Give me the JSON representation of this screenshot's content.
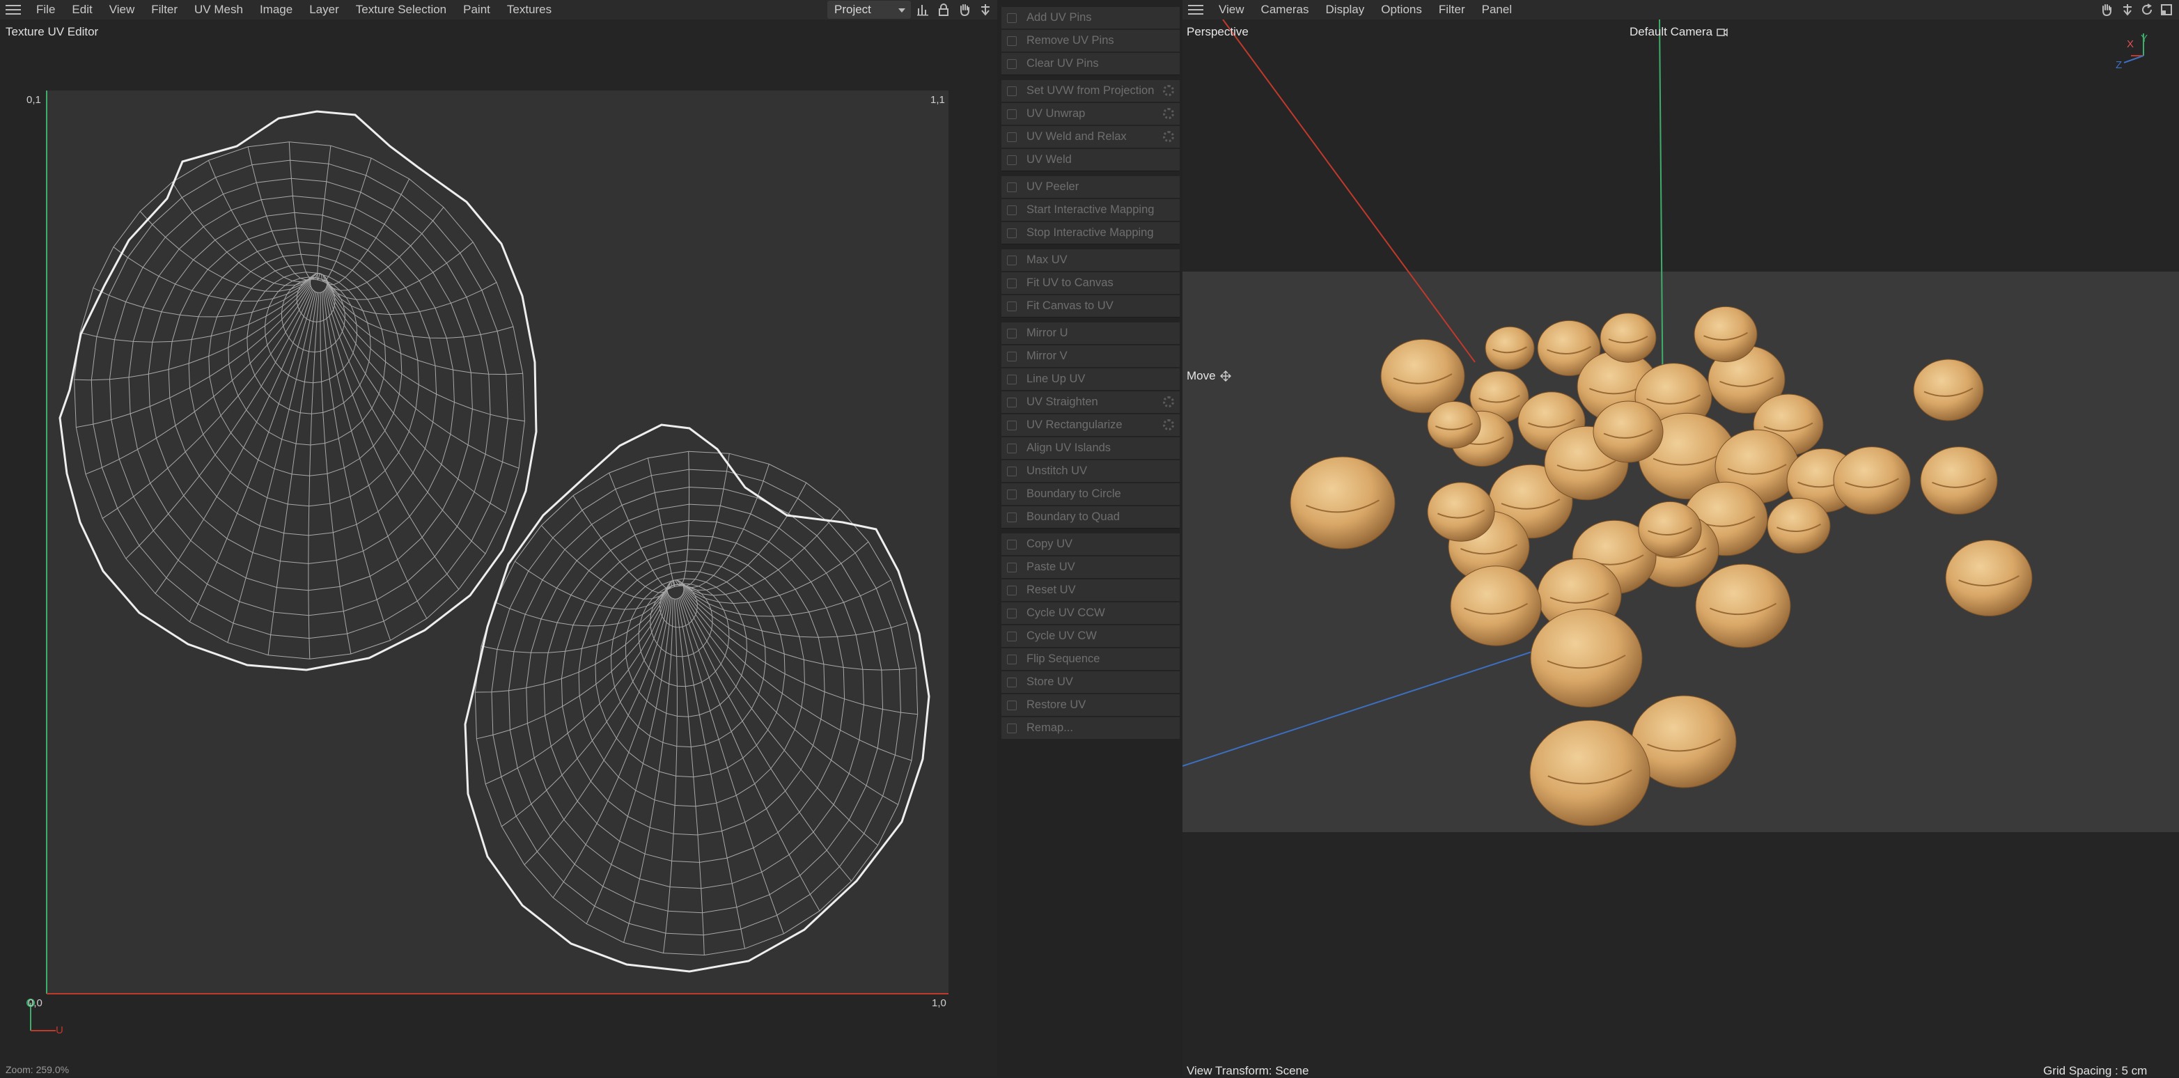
{
  "uv_editor": {
    "menu": [
      "File",
      "Edit",
      "View",
      "Filter",
      "UV Mesh",
      "Image",
      "Layer",
      "Texture Selection",
      "Paint",
      "Textures"
    ],
    "project_select": "Project",
    "title": "Texture UV Editor",
    "corner_labels": {
      "top_left": "0,1",
      "top_right": "1,1",
      "bottom_left": "0,0",
      "bottom_right": "1,0"
    },
    "axis_label_u": "U",
    "zoom_text": "Zoom: 259.0%"
  },
  "commands": [
    {
      "label": "Add UV Pins",
      "gear": false
    },
    {
      "label": "Remove UV Pins",
      "gear": false
    },
    {
      "label": "Clear UV Pins",
      "gear": false
    },
    {
      "label": "Set UVW from Projection",
      "gear": true
    },
    {
      "label": "UV Unwrap",
      "gear": true
    },
    {
      "label": "UV Weld and Relax",
      "gear": true
    },
    {
      "label": "UV Weld",
      "gear": false
    },
    {
      "label": "UV Peeler",
      "gear": false
    },
    {
      "label": "Start Interactive Mapping",
      "gear": false
    },
    {
      "label": "Stop Interactive Mapping",
      "gear": false
    },
    {
      "label": "Max UV",
      "gear": false
    },
    {
      "label": "Fit UV to Canvas",
      "gear": false
    },
    {
      "label": "Fit Canvas to UV",
      "gear": false
    },
    {
      "label": "Mirror U",
      "gear": false
    },
    {
      "label": "Mirror V",
      "gear": false
    },
    {
      "label": "Line Up UV",
      "gear": false
    },
    {
      "label": "UV Straighten",
      "gear": true
    },
    {
      "label": "UV Rectangularize",
      "gear": true
    },
    {
      "label": "Align UV Islands",
      "gear": false
    },
    {
      "label": "Unstitch UV",
      "gear": false
    },
    {
      "label": "Boundary to Circle",
      "gear": false
    },
    {
      "label": "Boundary to Quad",
      "gear": false
    },
    {
      "label": "Copy UV",
      "gear": false
    },
    {
      "label": "Paste UV",
      "gear": false
    },
    {
      "label": "Reset UV",
      "gear": false
    },
    {
      "label": "Cycle UV CCW",
      "gear": false
    },
    {
      "label": "Cycle UV CW",
      "gear": false
    },
    {
      "label": "Flip Sequence",
      "gear": false
    },
    {
      "label": "Store UV",
      "gear": false
    },
    {
      "label": "Restore UV",
      "gear": false
    },
    {
      "label": "Remap...",
      "gear": false
    }
  ],
  "viewport": {
    "menu": [
      "View",
      "Cameras",
      "Display",
      "Options",
      "Filter",
      "Panel"
    ],
    "perspective_label": "Perspective",
    "camera_label": "Default Camera",
    "move_label": "Move",
    "axis_x": "X",
    "axis_y": "Y",
    "axis_z": "Z",
    "view_transform": "View Transform: Scene",
    "grid_spacing": "Grid Spacing : 5 cm"
  },
  "colors": {
    "accent_green": "#3fae6a",
    "accent_red": "#c0392b",
    "accent_blue": "#3d6fbf",
    "chickpea": "#d9a868"
  }
}
